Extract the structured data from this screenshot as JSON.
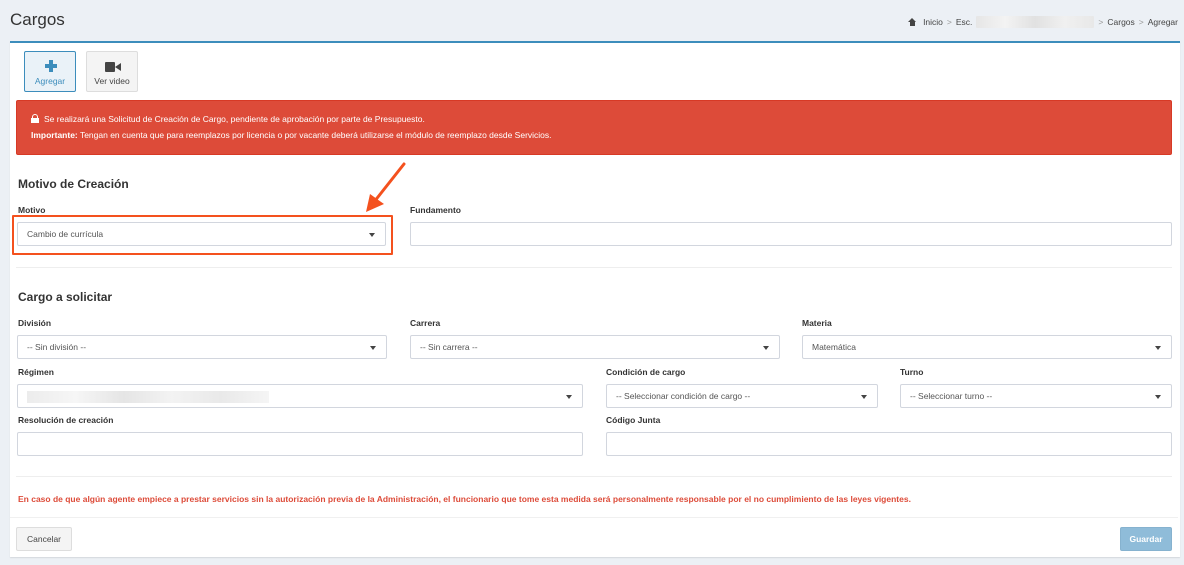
{
  "page": {
    "title": "Cargos"
  },
  "breadcrumb": {
    "home": "Inicio",
    "school": "Esc.",
    "section": "Cargos",
    "current": "Agregar",
    "separator": ">"
  },
  "toolbar": {
    "add_label": "Agregar",
    "video_label": "Ver video",
    "add_icon": "plus-icon",
    "video_icon": "video-camera-icon"
  },
  "alert": {
    "line1": "Se realizará una Solicitud de Creación de Cargo, pendiente de aprobación por parte de Presupuesto.",
    "line2_bold": "Importante:",
    "line2": " Tengan en cuenta que para reemplazos por licencia o por vacante deberá utilizarse el módulo de reemplazo desde Servicios.",
    "color": "#dd4b39"
  },
  "motivo_section": {
    "title": "Motivo de Creación",
    "motivo_label": "Motivo",
    "motivo_value": "Cambio de currícula",
    "fundamento_label": "Fundamento",
    "fundamento_value": ""
  },
  "cargo_section": {
    "title": "Cargo a solicitar",
    "division_label": "División",
    "division_value": "-- Sin división --",
    "carrera_label": "Carrera",
    "carrera_value": "-- Sin carrera --",
    "materia_label": "Materia",
    "materia_value": "Matemática",
    "regimen_label": "Régimen",
    "regimen_value": "",
    "condicion_label": "Condición de cargo",
    "condicion_value": "-- Seleccionar condición de cargo --",
    "turno_label": "Turno",
    "turno_value": "-- Seleccionar turno --",
    "resolucion_label": "Resolución de creación",
    "resolucion_value": "",
    "codigo_label": "Código Junta",
    "codigo_value": ""
  },
  "warning": "En caso de que algún agente empiece a prestar servicios sin la autorización previa de la Administración, el funcionario que tome esta medida será personalmente responsable por el no cumplimiento de las leyes vigentes.",
  "footer": {
    "cancel_label": "Cancelar",
    "save_label": "Guardar"
  },
  "colors": {
    "primary": "#3c8dbc",
    "danger": "#dd4b39",
    "annotation": "#f4511e",
    "save_disabled": "#8fbcd9"
  }
}
